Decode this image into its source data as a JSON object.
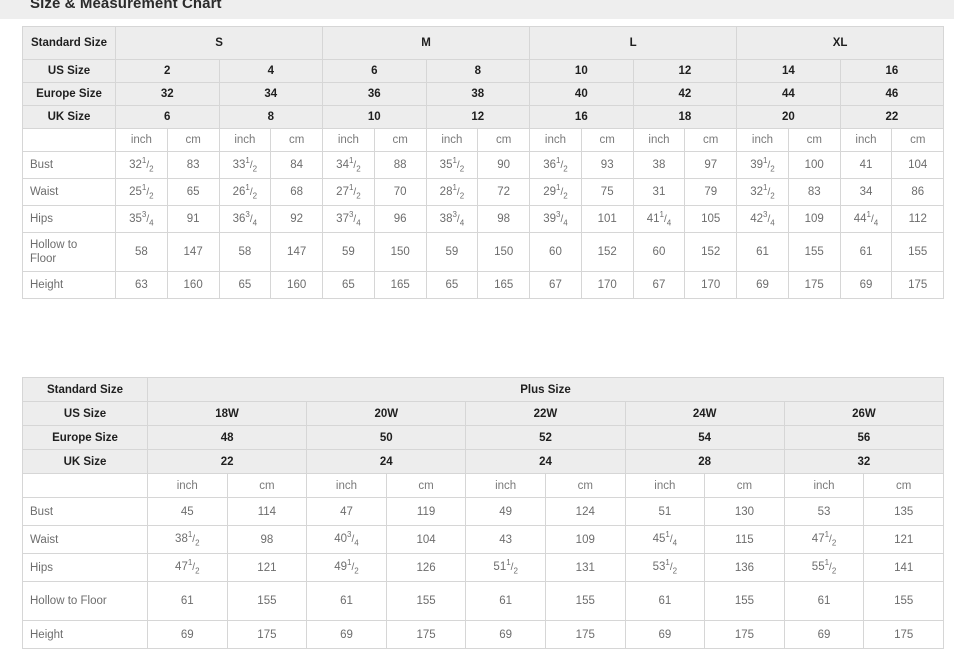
{
  "page": {
    "title": "Size & Measurement Chart",
    "title_band_color": "#eeeeee",
    "header_cell_color": "#ededed",
    "border_color": "#d6d6d6",
    "text_color": "#6d6d6d"
  },
  "standard_chart": {
    "corner_label": "Standard Size",
    "groups": [
      {
        "label": "S",
        "span": 2
      },
      {
        "label": "M",
        "span": 2
      },
      {
        "label": "L",
        "span": 2
      },
      {
        "label": "XL",
        "span": 2
      }
    ],
    "size_rows": [
      {
        "label": "US Size",
        "values": [
          "2",
          "4",
          "6",
          "8",
          "10",
          "12",
          "14",
          "16"
        ]
      },
      {
        "label": "Europe Size",
        "values": [
          "32",
          "34",
          "36",
          "38",
          "40",
          "42",
          "44",
          "46"
        ]
      },
      {
        "label": "UK Size",
        "values": [
          "6",
          "8",
          "10",
          "12",
          "16",
          "18",
          "20",
          "22"
        ]
      }
    ],
    "unit_row": {
      "label": "",
      "units": [
        "inch",
        "cm",
        "inch",
        "cm",
        "inch",
        "cm",
        "inch",
        "cm",
        "inch",
        "cm",
        "inch",
        "cm",
        "inch",
        "cm",
        "inch",
        "cm"
      ]
    },
    "measure_rows": [
      {
        "label": "Bust",
        "cells": [
          {
            "w": "32",
            "n": "1",
            "d": "2"
          },
          {
            "w": "83"
          },
          {
            "w": "33",
            "n": "1",
            "d": "2"
          },
          {
            "w": "84"
          },
          {
            "w": "34",
            "n": "1",
            "d": "2"
          },
          {
            "w": "88"
          },
          {
            "w": "35",
            "n": "1",
            "d": "2"
          },
          {
            "w": "90"
          },
          {
            "w": "36",
            "n": "1",
            "d": "2"
          },
          {
            "w": "93"
          },
          {
            "w": "38"
          },
          {
            "w": "97"
          },
          {
            "w": "39",
            "n": "1",
            "d": "2"
          },
          {
            "w": "100"
          },
          {
            "w": "41"
          },
          {
            "w": "104"
          }
        ]
      },
      {
        "label": "Waist",
        "cells": [
          {
            "w": "25",
            "n": "1",
            "d": "2"
          },
          {
            "w": "65"
          },
          {
            "w": "26",
            "n": "1",
            "d": "2"
          },
          {
            "w": "68"
          },
          {
            "w": "27",
            "n": "1",
            "d": "2"
          },
          {
            "w": "70"
          },
          {
            "w": "28",
            "n": "1",
            "d": "2"
          },
          {
            "w": "72"
          },
          {
            "w": "29",
            "n": "1",
            "d": "2"
          },
          {
            "w": "75"
          },
          {
            "w": "31"
          },
          {
            "w": "79"
          },
          {
            "w": "32",
            "n": "1",
            "d": "2"
          },
          {
            "w": "83"
          },
          {
            "w": "34"
          },
          {
            "w": "86"
          }
        ]
      },
      {
        "label": "Hips",
        "cells": [
          {
            "w": "35",
            "n": "3",
            "d": "4"
          },
          {
            "w": "91"
          },
          {
            "w": "36",
            "n": "3",
            "d": "4"
          },
          {
            "w": "92"
          },
          {
            "w": "37",
            "n": "3",
            "d": "4"
          },
          {
            "w": "96"
          },
          {
            "w": "38",
            "n": "3",
            "d": "4"
          },
          {
            "w": "98"
          },
          {
            "w": "39",
            "n": "3",
            "d": "4"
          },
          {
            "w": "101"
          },
          {
            "w": "41",
            "n": "1",
            "d": "4"
          },
          {
            "w": "105"
          },
          {
            "w": "42",
            "n": "3",
            "d": "4"
          },
          {
            "w": "109"
          },
          {
            "w": "44",
            "n": "1",
            "d": "4"
          },
          {
            "w": "112"
          }
        ]
      },
      {
        "label": "Hollow to Floor",
        "tall": true,
        "cells": [
          {
            "w": "58"
          },
          {
            "w": "147"
          },
          {
            "w": "58"
          },
          {
            "w": "147"
          },
          {
            "w": "59"
          },
          {
            "w": "150"
          },
          {
            "w": "59"
          },
          {
            "w": "150"
          },
          {
            "w": "60"
          },
          {
            "w": "152"
          },
          {
            "w": "60"
          },
          {
            "w": "152"
          },
          {
            "w": "61"
          },
          {
            "w": "155"
          },
          {
            "w": "61"
          },
          {
            "w": "155"
          }
        ]
      },
      {
        "label": "Height",
        "cells": [
          {
            "w": "63"
          },
          {
            "w": "160"
          },
          {
            "w": "65"
          },
          {
            "w": "160"
          },
          {
            "w": "65"
          },
          {
            "w": "165"
          },
          {
            "w": "65"
          },
          {
            "w": "165"
          },
          {
            "w": "67"
          },
          {
            "w": "170"
          },
          {
            "w": "67"
          },
          {
            "w": "170"
          },
          {
            "w": "69"
          },
          {
            "w": "175"
          },
          {
            "w": "69"
          },
          {
            "w": "175"
          }
        ]
      }
    ]
  },
  "plus_chart": {
    "corner_label": "Standard Size",
    "group_label": "Plus Size",
    "size_rows": [
      {
        "label": "US Size",
        "values": [
          "18W",
          "20W",
          "22W",
          "24W",
          "26W"
        ]
      },
      {
        "label": "Europe Size",
        "values": [
          "48",
          "50",
          "52",
          "54",
          "56"
        ]
      },
      {
        "label": "UK Size",
        "values": [
          "22",
          "24",
          "24",
          "28",
          "32"
        ]
      }
    ],
    "unit_row": {
      "label": "",
      "units": [
        "inch",
        "cm",
        "inch",
        "cm",
        "inch",
        "cm",
        "inch",
        "cm",
        "inch",
        "cm"
      ]
    },
    "measure_rows": [
      {
        "label": "Bust",
        "cells": [
          {
            "w": "45"
          },
          {
            "w": "114"
          },
          {
            "w": "47"
          },
          {
            "w": "119"
          },
          {
            "w": "49"
          },
          {
            "w": "124"
          },
          {
            "w": "51"
          },
          {
            "w": "130"
          },
          {
            "w": "53"
          },
          {
            "w": "135"
          }
        ]
      },
      {
        "label": "Waist",
        "cells": [
          {
            "w": "38",
            "n": "1",
            "d": "2"
          },
          {
            "w": "98"
          },
          {
            "w": "40",
            "n": "3",
            "d": "4"
          },
          {
            "w": "104"
          },
          {
            "w": "43"
          },
          {
            "w": "109"
          },
          {
            "w": "45",
            "n": "1",
            "d": "4"
          },
          {
            "w": "115"
          },
          {
            "w": "47",
            "n": "1",
            "d": "2"
          },
          {
            "w": "121"
          }
        ]
      },
      {
        "label": "Hips",
        "cells": [
          {
            "w": "47",
            "n": "1",
            "d": "2"
          },
          {
            "w": "121"
          },
          {
            "w": "49",
            "n": "1",
            "d": "2"
          },
          {
            "w": "126"
          },
          {
            "w": "51",
            "n": "1",
            "d": "2"
          },
          {
            "w": "131"
          },
          {
            "w": "53",
            "n": "1",
            "d": "2"
          },
          {
            "w": "136"
          },
          {
            "w": "55",
            "n": "1",
            "d": "2"
          },
          {
            "w": "141"
          }
        ]
      },
      {
        "label": "Hollow to Floor",
        "tall": true,
        "cells": [
          {
            "w": "61"
          },
          {
            "w": "155"
          },
          {
            "w": "61"
          },
          {
            "w": "155"
          },
          {
            "w": "61"
          },
          {
            "w": "155"
          },
          {
            "w": "61"
          },
          {
            "w": "155"
          },
          {
            "w": "61"
          },
          {
            "w": "155"
          }
        ]
      },
      {
        "label": "Height",
        "cells": [
          {
            "w": "69"
          },
          {
            "w": "175"
          },
          {
            "w": "69"
          },
          {
            "w": "175"
          },
          {
            "w": "69"
          },
          {
            "w": "175"
          },
          {
            "w": "69"
          },
          {
            "w": "175"
          },
          {
            "w": "69"
          },
          {
            "w": "175"
          }
        ]
      }
    ]
  }
}
